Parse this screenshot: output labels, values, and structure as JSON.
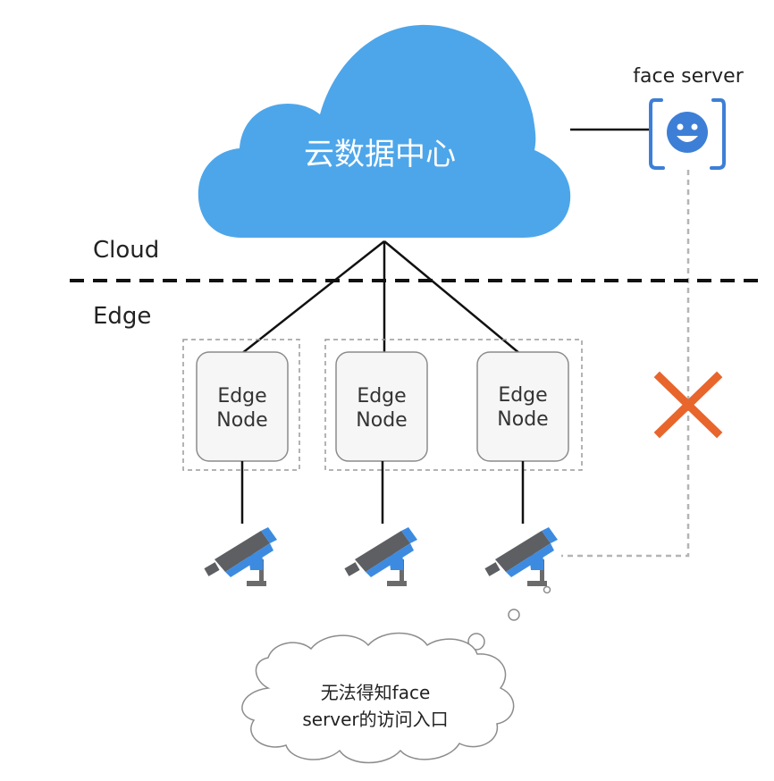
{
  "cloud": {
    "title": "云数据中心",
    "color": "#4da6ea"
  },
  "zones": {
    "cloud_label": "Cloud",
    "edge_label": "Edge"
  },
  "face_server": {
    "label": "face server",
    "icon": "face-scan-icon",
    "color": "#3d7fd6"
  },
  "edge_nodes": [
    {
      "line1": "Edge",
      "line2": "Node"
    },
    {
      "line1": "Edge",
      "line2": "Node"
    },
    {
      "line1": "Edge",
      "line2": "Node"
    }
  ],
  "cameras": [
    {
      "icon": "security-camera-icon"
    },
    {
      "icon": "security-camera-icon"
    },
    {
      "icon": "security-camera-icon"
    }
  ],
  "blocked_connection": {
    "icon": "cross-icon",
    "color": "#e8652c"
  },
  "thought_bubble": {
    "line1": "无法得知face",
    "line2": "server的访问入口"
  }
}
